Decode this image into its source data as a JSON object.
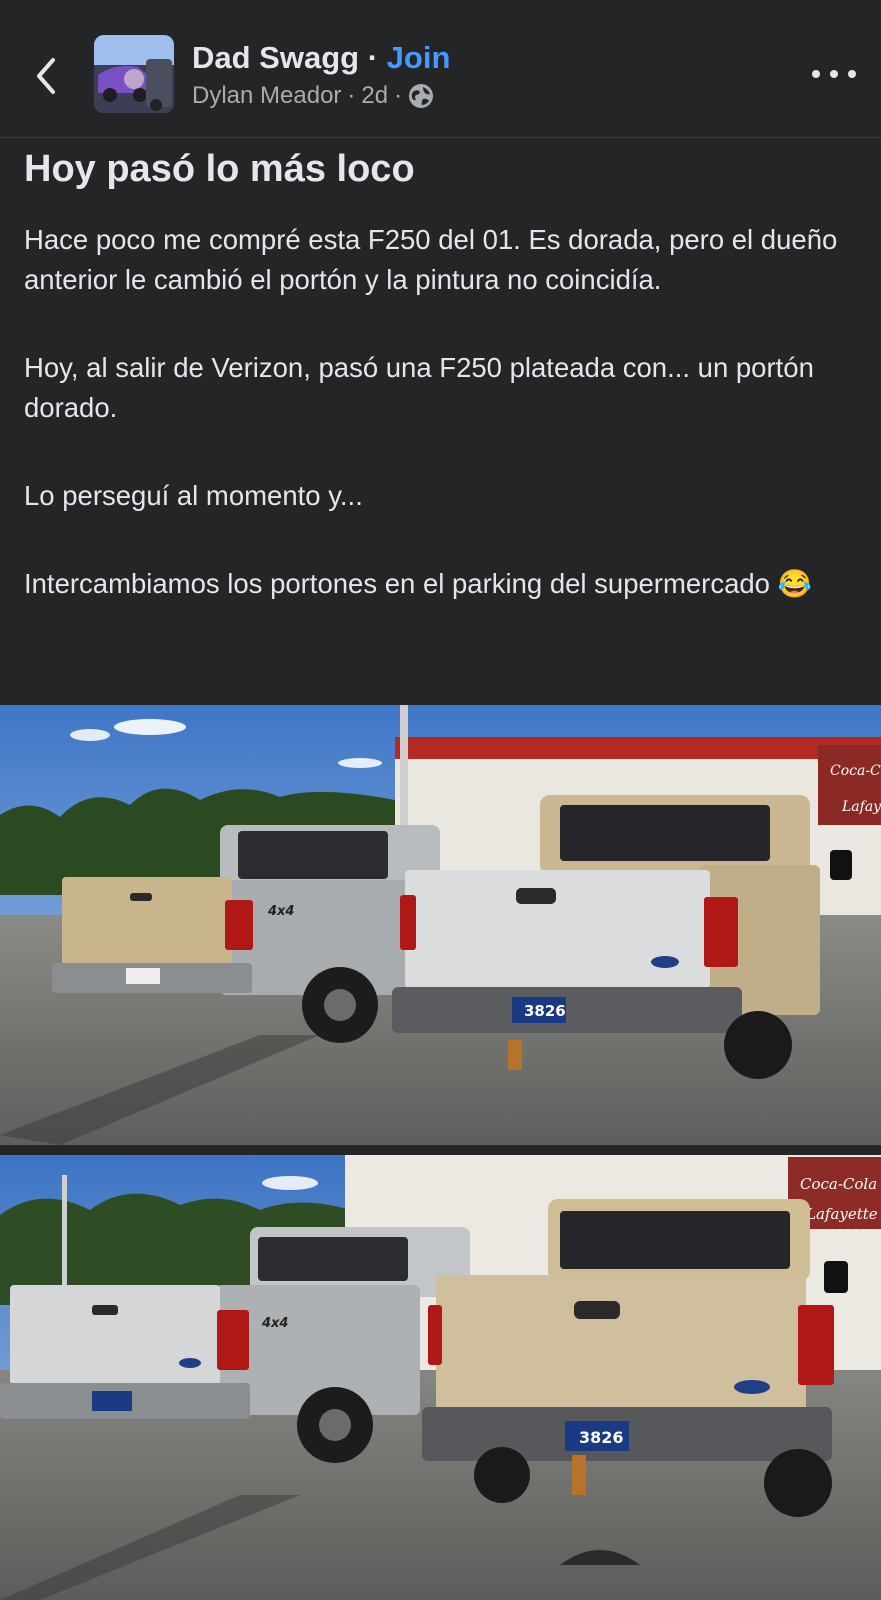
{
  "header": {
    "group_name": "Dad Swagg",
    "separator": "·",
    "join_label": "Join",
    "author": "Dylan Meador",
    "time": "2d",
    "dot": "·",
    "privacy_icon": "globe-icon",
    "back_icon": "chevron-left-icon",
    "more_icon": "more-horizontal-icon"
  },
  "post": {
    "title": "Hoy pasó lo más loco",
    "paragraphs": [
      "Hace poco me compré esta F250 del 01. Es dorada, pero el dueño anterior le cambió el portón y la pintura no coincidía.",
      "Hoy, al salir de Verizon, pasó una F250 plateada con... un portón dorado.",
      "Lo perseguí al momento y...",
      "Intercambiamos los portones en el parking del supermercado 😂"
    ]
  },
  "photos": {
    "sign_text_1": "Coca-Cola",
    "sign_text_2": "Lafayette",
    "plate_number": "3826",
    "badge_4x4": "4x4"
  },
  "colors": {
    "background": "#242526",
    "text": "#e4e6eb",
    "secondary_text": "#a8abaf",
    "link": "#4599ff"
  }
}
